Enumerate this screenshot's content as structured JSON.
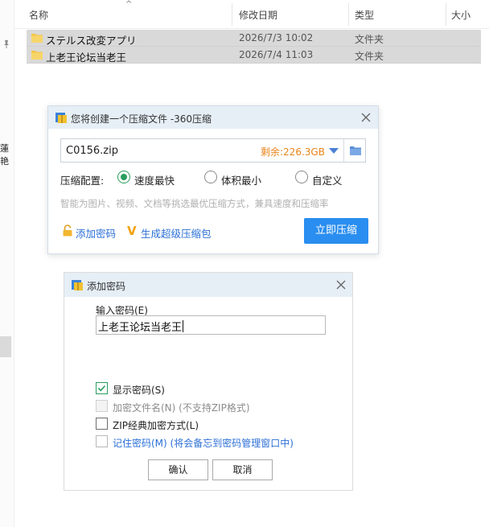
{
  "explorer": {
    "columns": {
      "name": "名称",
      "modified": "修改日期",
      "type": "类型",
      "size": "大小"
    },
    "sidebar_fragment": "蓮艳",
    "files": [
      {
        "name": "ステルス改変アプリ",
        "modified": "2026/7/3 10:02",
        "type": "文件夹"
      },
      {
        "name": "上老王论坛当老王",
        "modified": "2026/7/4 11:03",
        "type": "文件夹"
      }
    ]
  },
  "compress_dialog": {
    "title": "您将创建一个压缩文件 -360压缩",
    "filename": "C0156.zip",
    "remaining": "剩余:226.3GB",
    "config_label": "压缩配置:",
    "options": [
      "速度最快",
      "体积最小",
      "自定义"
    ],
    "selected_option": "速度最快",
    "hint": "智能为图片、视频、文档等挑选最优压缩方式，兼具速度和压缩率",
    "add_password_link": "添加密码",
    "super_package_link": "生成超级压缩包",
    "compress_button": "立即压缩",
    "accent_color": "#2a8ef0"
  },
  "password_dialog": {
    "title": "添加密码",
    "input_label": "输入密码(E)",
    "password_value": "上老王论坛当老王",
    "checkboxes": [
      {
        "label": "显示密码(S)",
        "checked": true,
        "enabled": true
      },
      {
        "label": "加密文件名(N) (不支持ZIP格式)",
        "checked": false,
        "enabled": false
      },
      {
        "label": "ZIP经典加密方式(L)",
        "checked": false,
        "enabled": true
      },
      {
        "label": "记住密码(M) (将会备忘到密码管理窗口中)",
        "checked": false,
        "enabled": true
      }
    ],
    "ok_button": "确认",
    "cancel_button": "取消"
  }
}
